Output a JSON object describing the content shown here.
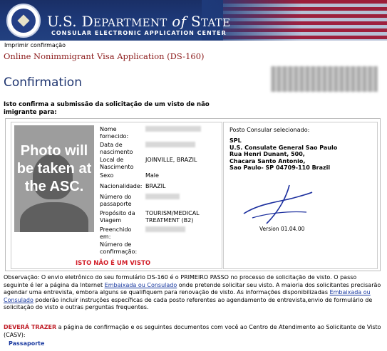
{
  "header": {
    "dept_prefix": "U.S. D",
    "dept_main": "EPARTMENT",
    "dept_of": "of",
    "dept_state": "S",
    "dept_tate": "TATE",
    "subtitle": "CONSULAR ELECTRONIC APPLICATION CENTER"
  },
  "print_link": "Imprimir confirmação",
  "app_title": "Online Nonimmigrant Visa Application (DS-160)",
  "page_title": "Confirmation",
  "intro": "Isto confirma a submissão da solicitação de um visto de não imigrante para:",
  "applicant": {
    "fields": [
      {
        "label": "Nome fornecido:",
        "value": ""
      },
      {
        "label": "Data de nascimento",
        "value": ""
      },
      {
        "label": "Local de Nascimento",
        "value": "JOINVILLE, BRAZIL"
      },
      {
        "label": "Sexo",
        "value": "Male"
      },
      {
        "label": "Nacionalidade:",
        "value": "BRAZIL"
      },
      {
        "label": "Número do passaporte",
        "value": ""
      },
      {
        "label": "Propósito da Viagem",
        "value": "TOURISM/MEDICAL TREATMENT (B2)"
      },
      {
        "label": "Preenchido em:",
        "value": ""
      },
      {
        "label": "Número de confirmação:",
        "value": ""
      }
    ],
    "not_visa": "ISTO NÃO É UM VISTO"
  },
  "photo_placeholder": "Photo will be taken at the ASC.",
  "consulate": {
    "title": "Posto Consular selecionado:",
    "code": "SPL",
    "lines": [
      "U.S. Consulate General Sao Paulo",
      "Rua Henri Dunant, 500,",
      "Chacara Santo Antonio,",
      "Sao Paulo- SP 04709-110 Brazil"
    ],
    "version": "Version 01.04.00"
  },
  "observation": {
    "part1": "Observação: O envio eletrônico do seu formulário DS-160 é o PRIMEIRO PASSO no processo de solicitação de visto. O passo seguinte é ler a página da Internet ",
    "link1": "Embaixada ou Consulado",
    "part2": " onde pretende solicitar seu visto. A maioria dos solicitantes precisarão agendar uma entrevista, embora alguns se qualifiquem para renovação de visto. As informações disponibilizadas ",
    "link2": "Embaixada ou Consulado",
    "part3": " poderão incluir instruções específicas de cada posto referentes ao agendamento de entrevista,envio de formulário de solicitação do visto e outras perguntas frequentes."
  },
  "must_bring": {
    "bold": "DEVERÁ TRAZER",
    "text": " a página de confirmação e os seguintes documentos com você ao Centro de Atendimento ao Solicitante de Visto (CASV):"
  },
  "documents": [
    "Passaporte"
  ],
  "colors": {
    "brand_blue": "#1f3570",
    "title_red": "#8b1a1a",
    "warning_red": "#d2202a",
    "link_blue": "#1a3aa0"
  }
}
